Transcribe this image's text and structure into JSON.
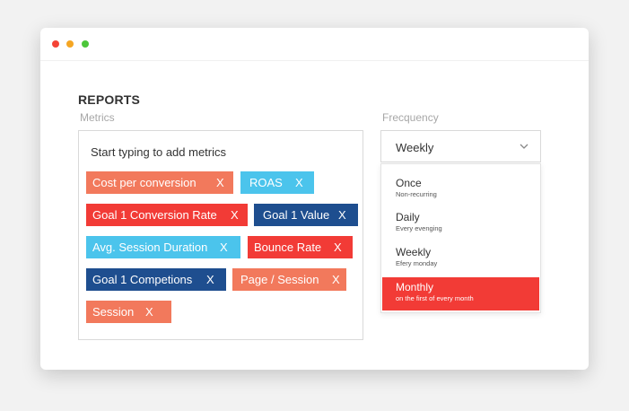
{
  "colors": {
    "orange": "#f2795c",
    "cyan": "#4bc4ec",
    "red": "#f23b36",
    "navy": "#1e4e8f"
  },
  "icons": [
    "close-dot-icon",
    "minimize-dot-icon",
    "maximize-dot-icon",
    "chevron-down-icon"
  ],
  "page": {
    "title": "REPORTS",
    "metrics_label": "Metrics",
    "frequency_label": "Frecquency"
  },
  "metrics": {
    "placeholder": "Start typing to add metrics",
    "remove_label": "X",
    "chips": [
      {
        "label": "Cost per conversion",
        "color": "orange"
      },
      {
        "label": "ROAS",
        "color": "cyan"
      },
      {
        "label": "Goal 1 Conversion Rate",
        "color": "red"
      },
      {
        "label": "Goal 1 Value",
        "color": "navy"
      },
      {
        "label": "Avg. Session Duration",
        "color": "cyan"
      },
      {
        "label": "Bounce Rate",
        "color": "red"
      },
      {
        "label": "Goal 1 Competions",
        "color": "navy"
      },
      {
        "label": "Page / Session",
        "color": "orange"
      },
      {
        "label": "Session",
        "color": "orange"
      }
    ]
  },
  "frequency": {
    "selected": "Weekly",
    "options": [
      {
        "title": "Once",
        "subtitle": "Non-recurring"
      },
      {
        "title": "Daily",
        "subtitle": "Every evenging"
      },
      {
        "title": "Weekly",
        "subtitle": "Efery monday"
      },
      {
        "title": "Monthly",
        "subtitle": "on the first of every month",
        "highlighted": true
      }
    ]
  }
}
